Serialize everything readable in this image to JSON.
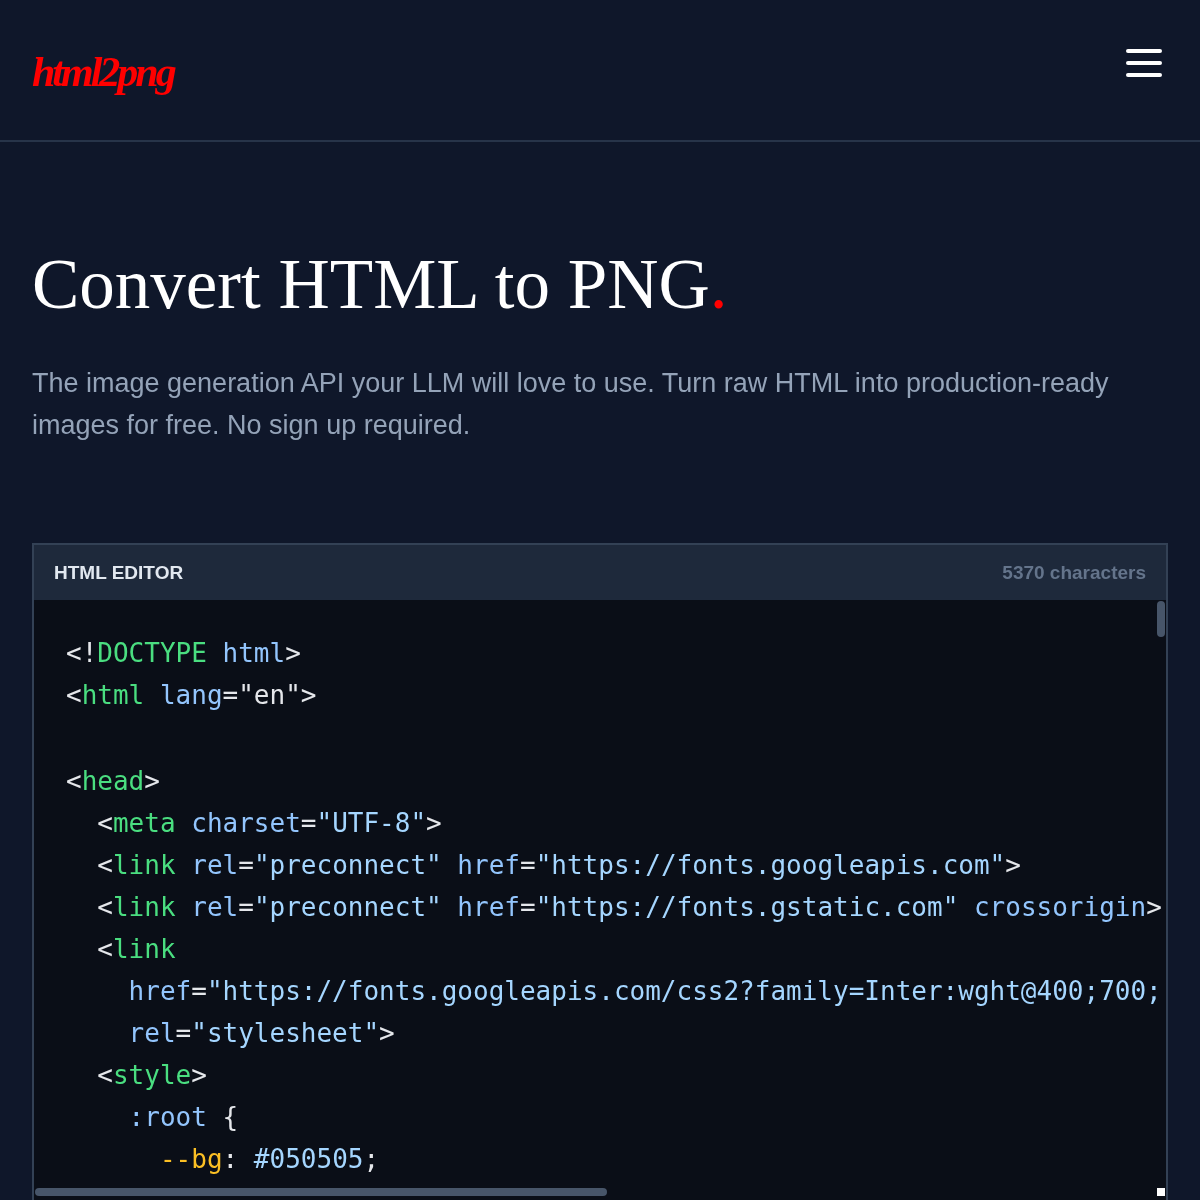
{
  "header": {
    "logo": "html2png"
  },
  "hero": {
    "title": "Convert HTML to PNG",
    "title_mark": ".",
    "subtitle": "The image generation API your LLM will love to use. Turn raw HTML into production-ready images for free. No sign up required."
  },
  "editor": {
    "label": "HTML EDITOR",
    "count": "5370 characters",
    "lines": [
      {
        "space_above": false,
        "tokens": [
          {
            "kind": "punct",
            "text": "<!"
          },
          {
            "kind": "tag",
            "text": "DOCTYPE"
          },
          {
            "kind": "attr",
            "text": " html"
          },
          {
            "kind": "punct",
            "text": ">"
          }
        ]
      },
      {
        "space_above": false,
        "tokens": [
          {
            "kind": "punct",
            "text": "<"
          },
          {
            "kind": "tag",
            "text": "html"
          },
          {
            "kind": "attr",
            "text": " lang"
          },
          {
            "kind": "punct",
            "text": "="
          },
          {
            "kind": "plain",
            "text": "\"en\""
          },
          {
            "kind": "punct",
            "text": ">"
          }
        ]
      },
      {
        "space_above": true,
        "tokens": [
          {
            "kind": "punct",
            "text": "<"
          },
          {
            "kind": "tag",
            "text": "head"
          },
          {
            "kind": "punct",
            "text": ">"
          }
        ]
      },
      {
        "space_above": false,
        "tokens": [
          {
            "kind": "punct",
            "text": "  <"
          },
          {
            "kind": "tag",
            "text": "meta"
          },
          {
            "kind": "attr",
            "text": " charset"
          },
          {
            "kind": "punct",
            "text": "="
          },
          {
            "kind": "string",
            "text": "\"UTF-8\""
          },
          {
            "kind": "punct",
            "text": ">"
          }
        ]
      },
      {
        "space_above": false,
        "tokens": [
          {
            "kind": "punct",
            "text": "  <"
          },
          {
            "kind": "tag",
            "text": "link"
          },
          {
            "kind": "attr",
            "text": " rel"
          },
          {
            "kind": "punct",
            "text": "="
          },
          {
            "kind": "string",
            "text": "\"preconnect\""
          },
          {
            "kind": "attr",
            "text": " href"
          },
          {
            "kind": "punct",
            "text": "="
          },
          {
            "kind": "string",
            "text": "\"https://fonts.googleapis.com\""
          },
          {
            "kind": "punct",
            "text": ">"
          }
        ]
      },
      {
        "space_above": false,
        "tokens": [
          {
            "kind": "punct",
            "text": "  <"
          },
          {
            "kind": "tag",
            "text": "link"
          },
          {
            "kind": "attr",
            "text": " rel"
          },
          {
            "kind": "punct",
            "text": "="
          },
          {
            "kind": "string",
            "text": "\"preconnect\""
          },
          {
            "kind": "attr",
            "text": " href"
          },
          {
            "kind": "punct",
            "text": "="
          },
          {
            "kind": "string",
            "text": "\"https://fonts.gstatic.com\""
          },
          {
            "kind": "attr",
            "text": " crossorigin"
          },
          {
            "kind": "punct",
            "text": ">"
          }
        ]
      },
      {
        "space_above": false,
        "tokens": [
          {
            "kind": "punct",
            "text": "  <"
          },
          {
            "kind": "tag",
            "text": "link"
          }
        ]
      },
      {
        "space_above": false,
        "tokens": [
          {
            "kind": "attr",
            "text": "    href"
          },
          {
            "kind": "punct",
            "text": "="
          },
          {
            "kind": "string",
            "text": "\"https://fonts.googleapis.com/css2?family=Inter:wght@400;700;"
          }
        ]
      },
      {
        "space_above": false,
        "tokens": [
          {
            "kind": "attr",
            "text": "    rel"
          },
          {
            "kind": "punct",
            "text": "="
          },
          {
            "kind": "string",
            "text": "\"stylesheet\""
          },
          {
            "kind": "punct",
            "text": ">"
          }
        ]
      },
      {
        "space_above": false,
        "tokens": [
          {
            "kind": "punct",
            "text": "  <"
          },
          {
            "kind": "tag",
            "text": "style"
          },
          {
            "kind": "punct",
            "text": ">"
          }
        ]
      },
      {
        "space_above": false,
        "tokens": [
          {
            "kind": "attr",
            "text": "    :root"
          },
          {
            "kind": "punct",
            "text": " {"
          }
        ]
      },
      {
        "space_above": false,
        "tokens": [
          {
            "kind": "prop",
            "text": "      --bg"
          },
          {
            "kind": "punct",
            "text": ": "
          },
          {
            "kind": "string",
            "text": "#050505"
          },
          {
            "kind": "punct",
            "text": ";"
          }
        ]
      }
    ]
  }
}
